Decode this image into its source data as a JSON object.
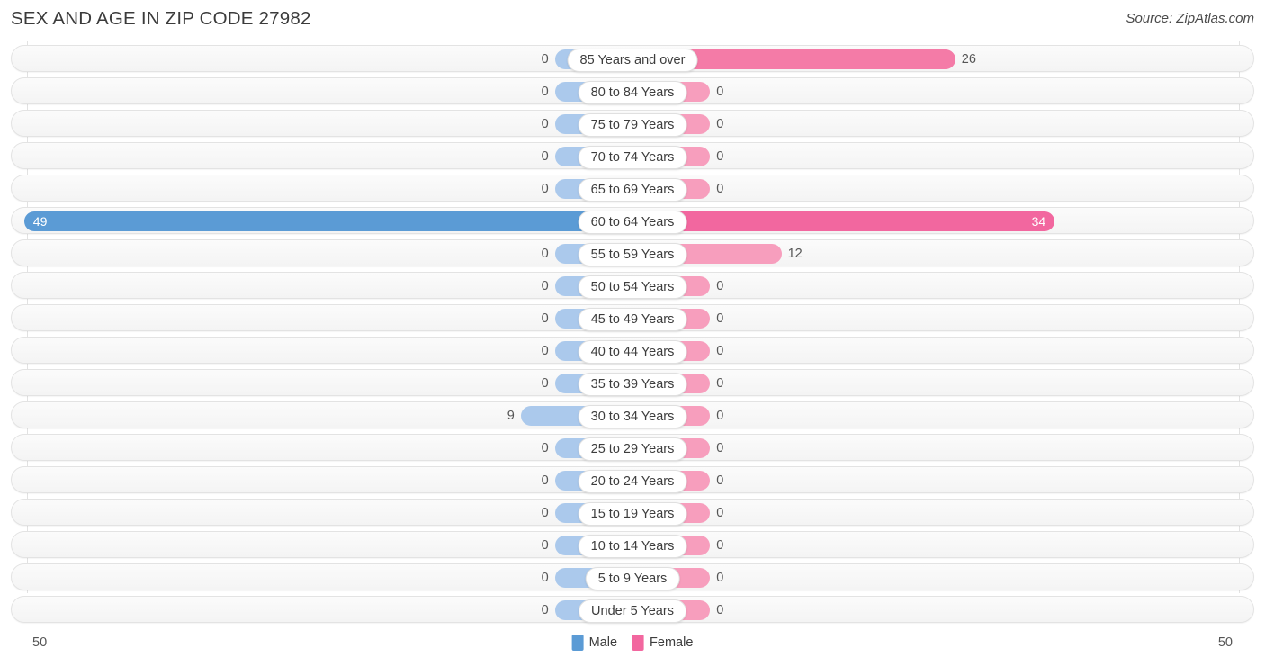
{
  "header": {
    "title": "SEX AND AGE IN ZIP CODE 27982",
    "source": "Source: ZipAtlas.com"
  },
  "axis": {
    "left_label": "50",
    "right_label": "50",
    "max": 50
  },
  "legend": {
    "items": [
      {
        "label": "Male",
        "color": "#5b9bd5"
      },
      {
        "label": "Female",
        "color": "#f2679f"
      }
    ]
  },
  "chart_data": {
    "type": "bar",
    "title": "SEX AND AGE IN ZIP CODE 27982",
    "subtitle": "Source: ZipAtlas.com",
    "orientation": "horizontal-diverging",
    "xlabel": "",
    "ylabel": "",
    "xlim": [
      50,
      50
    ],
    "grid": true,
    "legend_position": "bottom-center",
    "categories": [
      "85 Years and over",
      "80 to 84 Years",
      "75 to 79 Years",
      "70 to 74 Years",
      "65 to 69 Years",
      "60 to 64 Years",
      "55 to 59 Years",
      "50 to 54 Years",
      "45 to 49 Years",
      "40 to 44 Years",
      "35 to 39 Years",
      "30 to 34 Years",
      "25 to 29 Years",
      "20 to 24 Years",
      "15 to 19 Years",
      "10 to 14 Years",
      "5 to 9 Years",
      "Under 5 Years"
    ],
    "series": [
      {
        "name": "Male",
        "color": "#5b9bd5",
        "values": [
          0,
          0,
          0,
          0,
          0,
          49,
          0,
          0,
          0,
          0,
          0,
          9,
          0,
          0,
          0,
          0,
          0,
          0
        ]
      },
      {
        "name": "Female",
        "color": "#f2679f",
        "values": [
          26,
          0,
          0,
          0,
          0,
          34,
          12,
          0,
          0,
          0,
          0,
          0,
          0,
          0,
          0,
          0,
          0,
          0
        ]
      }
    ]
  },
  "rows": [
    {
      "category": "85 Years and over",
      "male": "0",
      "female": "26",
      "male_pct": 0,
      "female_pct": 52,
      "male_inside": false,
      "female_inside": false,
      "male_hi": false,
      "female_tone": "mid"
    },
    {
      "category": "80 to 84 Years",
      "male": "0",
      "female": "0",
      "male_pct": 0,
      "female_pct": 0,
      "male_inside": false,
      "female_inside": false,
      "male_hi": false,
      "female_tone": "low"
    },
    {
      "category": "75 to 79 Years",
      "male": "0",
      "female": "0",
      "male_pct": 0,
      "female_pct": 0,
      "male_inside": false,
      "female_inside": false,
      "male_hi": false,
      "female_tone": "low"
    },
    {
      "category": "70 to 74 Years",
      "male": "0",
      "female": "0",
      "male_pct": 0,
      "female_pct": 0,
      "male_inside": false,
      "female_inside": false,
      "male_hi": false,
      "female_tone": "low"
    },
    {
      "category": "65 to 69 Years",
      "male": "0",
      "female": "0",
      "male_pct": 0,
      "female_pct": 0,
      "male_inside": false,
      "female_inside": false,
      "male_hi": false,
      "female_tone": "low"
    },
    {
      "category": "60 to 64 Years",
      "male": "49",
      "female": "34",
      "male_pct": 98,
      "female_pct": 68,
      "male_inside": true,
      "female_inside": true,
      "male_hi": true,
      "female_tone": "hi"
    },
    {
      "category": "55 to 59 Years",
      "male": "0",
      "female": "12",
      "male_pct": 0,
      "female_pct": 24,
      "male_inside": false,
      "female_inside": false,
      "male_hi": false,
      "female_tone": "low"
    },
    {
      "category": "50 to 54 Years",
      "male": "0",
      "female": "0",
      "male_pct": 0,
      "female_pct": 0,
      "male_inside": false,
      "female_inside": false,
      "male_hi": false,
      "female_tone": "low"
    },
    {
      "category": "45 to 49 Years",
      "male": "0",
      "female": "0",
      "male_pct": 0,
      "female_pct": 0,
      "male_inside": false,
      "female_inside": false,
      "male_hi": false,
      "female_tone": "low"
    },
    {
      "category": "40 to 44 Years",
      "male": "0",
      "female": "0",
      "male_pct": 0,
      "female_pct": 0,
      "male_inside": false,
      "female_inside": false,
      "male_hi": false,
      "female_tone": "low"
    },
    {
      "category": "35 to 39 Years",
      "male": "0",
      "female": "0",
      "male_pct": 0,
      "female_pct": 0,
      "male_inside": false,
      "female_inside": false,
      "male_hi": false,
      "female_tone": "low"
    },
    {
      "category": "30 to 34 Years",
      "male": "9",
      "female": "0",
      "male_pct": 18,
      "female_pct": 0,
      "male_inside": false,
      "female_inside": false,
      "male_hi": false,
      "female_tone": "low"
    },
    {
      "category": "25 to 29 Years",
      "male": "0",
      "female": "0",
      "male_pct": 0,
      "female_pct": 0,
      "male_inside": false,
      "female_inside": false,
      "male_hi": false,
      "female_tone": "low"
    },
    {
      "category": "20 to 24 Years",
      "male": "0",
      "female": "0",
      "male_pct": 0,
      "female_pct": 0,
      "male_inside": false,
      "female_inside": false,
      "male_hi": false,
      "female_tone": "low"
    },
    {
      "category": "15 to 19 Years",
      "male": "0",
      "female": "0",
      "male_pct": 0,
      "female_pct": 0,
      "male_inside": false,
      "female_inside": false,
      "male_hi": false,
      "female_tone": "low"
    },
    {
      "category": "10 to 14 Years",
      "male": "0",
      "female": "0",
      "male_pct": 0,
      "female_pct": 0,
      "male_inside": false,
      "female_inside": false,
      "male_hi": false,
      "female_tone": "low"
    },
    {
      "category": "5 to 9 Years",
      "male": "0",
      "female": "0",
      "male_pct": 0,
      "female_pct": 0,
      "male_inside": false,
      "female_inside": false,
      "male_hi": false,
      "female_tone": "low"
    },
    {
      "category": "Under 5 Years",
      "male": "0",
      "female": "0",
      "male_pct": 0,
      "female_pct": 0,
      "male_inside": false,
      "female_inside": false,
      "male_hi": false,
      "female_tone": "low"
    }
  ]
}
